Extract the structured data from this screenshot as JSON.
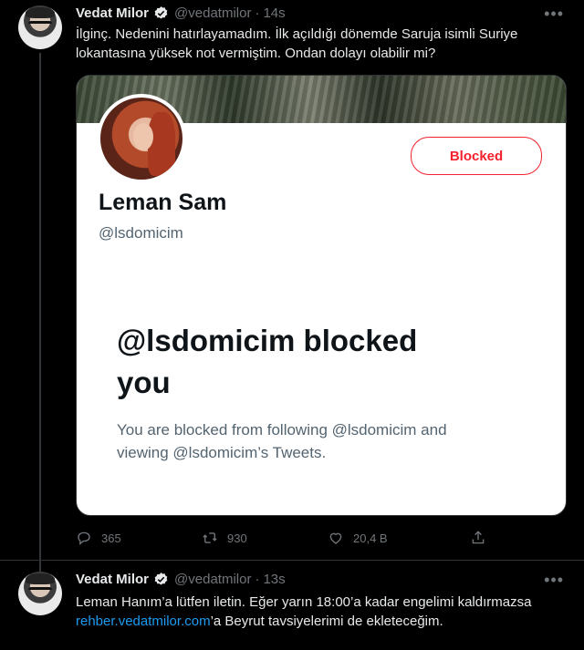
{
  "tweet1": {
    "author_name": "Vedat Milor",
    "handle": "@vedatmilor",
    "time": "14s",
    "text_line1": "İlginç. Nedenini hatırlayamadım. İlk açıldığı dönemde Saruja isimli Suriye",
    "text_line2": "lokantasına yüksek not vermiştim. Ondan dolayı olabilir mi?",
    "card": {
      "button_label": "Blocked",
      "name": "Leman Sam",
      "handle": "@lsdomicim",
      "heading_line1": "@lsdomicim blocked",
      "heading_line2": "you",
      "sub_line1": "You are blocked from following @lsdomicim and",
      "sub_line2": "viewing @lsdomicim’s Tweets."
    },
    "replies": "365",
    "retweets": "930",
    "likes": "20,4 B"
  },
  "tweet2": {
    "author_name": "Vedat Milor",
    "handle": "@vedatmilor",
    "time": "13s",
    "text_line1": "Leman Hanım’a lütfen iletin. Eğer yarın 18:00’a kadar engelimi kaldırmazsa",
    "link_text": "rehber.vedatmilor.com",
    "text_line2_rest": "’a Beyrut tavsiyelerimi de ekleteceğim."
  },
  "icons": {
    "verified": "verified-badge-icon",
    "more": "more-icon",
    "reply": "reply-icon",
    "retweet": "retweet-icon",
    "like": "heart-icon",
    "share": "share-icon"
  },
  "colors": {
    "background": "#000000",
    "text": "#e7e9ea",
    "muted": "#71767b",
    "link": "#1d9bf0",
    "blocked_red": "#f4212e"
  }
}
